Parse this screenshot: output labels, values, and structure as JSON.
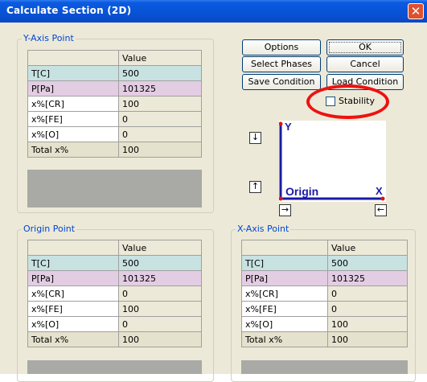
{
  "window": {
    "title": "Calculate Section (2D)",
    "close_glyph": "✕"
  },
  "buttons": {
    "options": "Options",
    "ok": "OK",
    "select_phases": "Select Phases",
    "cancel": "Cancel",
    "save_condition": "Save Condition",
    "load_condition": "Load Condition"
  },
  "stability": {
    "label": "Stability",
    "checked": false
  },
  "y_axis": {
    "legend": "Y-Axis Point",
    "header": "Value",
    "rows": [
      {
        "label": "T[C]",
        "value": "500"
      },
      {
        "label": "P[Pa]",
        "value": "101325"
      },
      {
        "label": "x%[CR]",
        "value": "100"
      },
      {
        "label": "x%[FE]",
        "value": "0"
      },
      {
        "label": "x%[O]",
        "value": "0"
      },
      {
        "label": "Total x%",
        "value": "100"
      }
    ]
  },
  "origin": {
    "legend": "Origin Point",
    "header": "Value",
    "rows": [
      {
        "label": "T[C]",
        "value": "500"
      },
      {
        "label": "P[Pa]",
        "value": "101325"
      },
      {
        "label": "x%[CR]",
        "value": "0"
      },
      {
        "label": "x%[FE]",
        "value": "100"
      },
      {
        "label": "x%[O]",
        "value": "0"
      },
      {
        "label": "Total x%",
        "value": "100"
      }
    ]
  },
  "x_axis": {
    "legend": "X-Axis Point",
    "header": "Value",
    "rows": [
      {
        "label": "T[C]",
        "value": "500"
      },
      {
        "label": "P[Pa]",
        "value": "101325"
      },
      {
        "label": "x%[CR]",
        "value": "0"
      },
      {
        "label": "x%[FE]",
        "value": "0"
      },
      {
        "label": "x%[O]",
        "value": "100"
      },
      {
        "label": "Total x%",
        "value": "100"
      }
    ]
  },
  "diagram": {
    "y_label": "Y",
    "x_label": "X",
    "origin_label": "Origin",
    "up_glyph": "↑",
    "down_glyph": "↓",
    "right_glyph": "→",
    "left_glyph": "←",
    "axis_color": "#1a1aa8",
    "point_color": "#e11111"
  }
}
